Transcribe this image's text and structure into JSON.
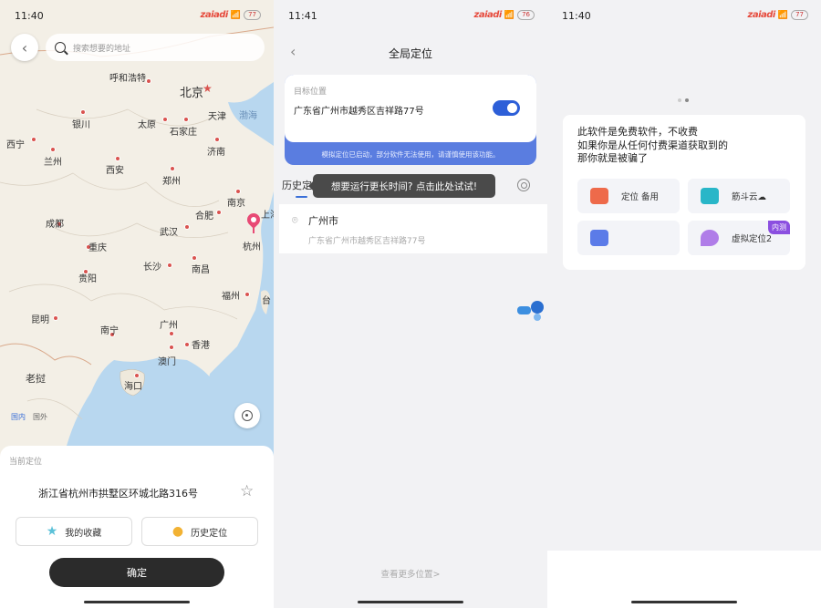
{
  "screen1": {
    "status": {
      "time": "11:40",
      "brand": "zaiadi",
      "battery": "77"
    },
    "search": {
      "placeholder": "搜索想要的地址"
    },
    "map": {
      "cities": [
        {
          "name": "呼和浩特",
          "big": false
        },
        {
          "name": "北京",
          "big": true
        },
        {
          "name": "天津",
          "big": false
        },
        {
          "name": "渤海",
          "big": false
        },
        {
          "name": "银川",
          "big": false
        },
        {
          "name": "太原",
          "big": false
        },
        {
          "name": "石家庄",
          "big": false
        },
        {
          "name": "西宁",
          "big": false
        },
        {
          "name": "兰州",
          "big": false
        },
        {
          "name": "济南",
          "big": false
        },
        {
          "name": "西安",
          "big": false
        },
        {
          "name": "郑州",
          "big": false
        },
        {
          "name": "南京",
          "big": false
        },
        {
          "name": "合肥",
          "big": false
        },
        {
          "name": "上海",
          "big": false
        },
        {
          "name": "成都",
          "big": false
        },
        {
          "name": "武汉",
          "big": false
        },
        {
          "name": "杭州",
          "big": false
        },
        {
          "name": "重庆",
          "big": false
        },
        {
          "name": "贵阳",
          "big": false
        },
        {
          "name": "长沙",
          "big": false
        },
        {
          "name": "南昌",
          "big": false
        },
        {
          "name": "福州",
          "big": false
        },
        {
          "name": "台",
          "big": false
        },
        {
          "name": "昆明",
          "big": false
        },
        {
          "name": "南宁",
          "big": false
        },
        {
          "name": "广州",
          "big": false
        },
        {
          "name": "香港",
          "big": false
        },
        {
          "name": "澳门",
          "big": false
        },
        {
          "name": "老挝",
          "big": true
        },
        {
          "name": "海口",
          "big": false
        }
      ],
      "region_domestic": "国内",
      "region_abroad": "国外"
    },
    "sheet": {
      "label": "当前定位",
      "address": "浙江省杭州市拱墅区环城北路316号",
      "favorites": "我的收藏",
      "history": "历史定位",
      "confirm": "确定"
    }
  },
  "screen2": {
    "status": {
      "time": "11:41",
      "brand": "zaiadi",
      "battery": "76"
    },
    "title": "全局定位",
    "target": {
      "label": "目标位置",
      "address": "广东省广州市越秀区吉祥路77号",
      "enabled": true,
      "warning": "模拟定位已启动，部分软件无法使用，请谨慎使用该功能。"
    },
    "history_head": "历史定位",
    "tooltip": "想要运行更长时间? 点击此处试试!",
    "history_items": [
      {
        "city": "广州市",
        "address": "广东省广州市越秀区吉祥路77号"
      }
    ],
    "more_link": "查看更多位置>"
  },
  "screen3": {
    "status": {
      "time": "11:40",
      "brand": "zaiadi",
      "battery": "77"
    },
    "notice": [
      "此软件是免费软件，不收费",
      "如果你是从任何付费渠道获取到的",
      "那你就是被骗了"
    ],
    "tiles": [
      {
        "label": "定位 备用",
        "color": "#ee6a4a",
        "badge": ""
      },
      {
        "label": "筋斗云☁",
        "color": "#29b6c8",
        "badge": ""
      },
      {
        "label": "",
        "color": "#5b7be8",
        "badge": ""
      },
      {
        "label": "虚拟定位2",
        "color": "#b07de8",
        "badge": "内测"
      }
    ]
  },
  "colors": {
    "accent": "#2d5fd8",
    "pin": "#e84a75",
    "beta": "#8b4fe0"
  }
}
